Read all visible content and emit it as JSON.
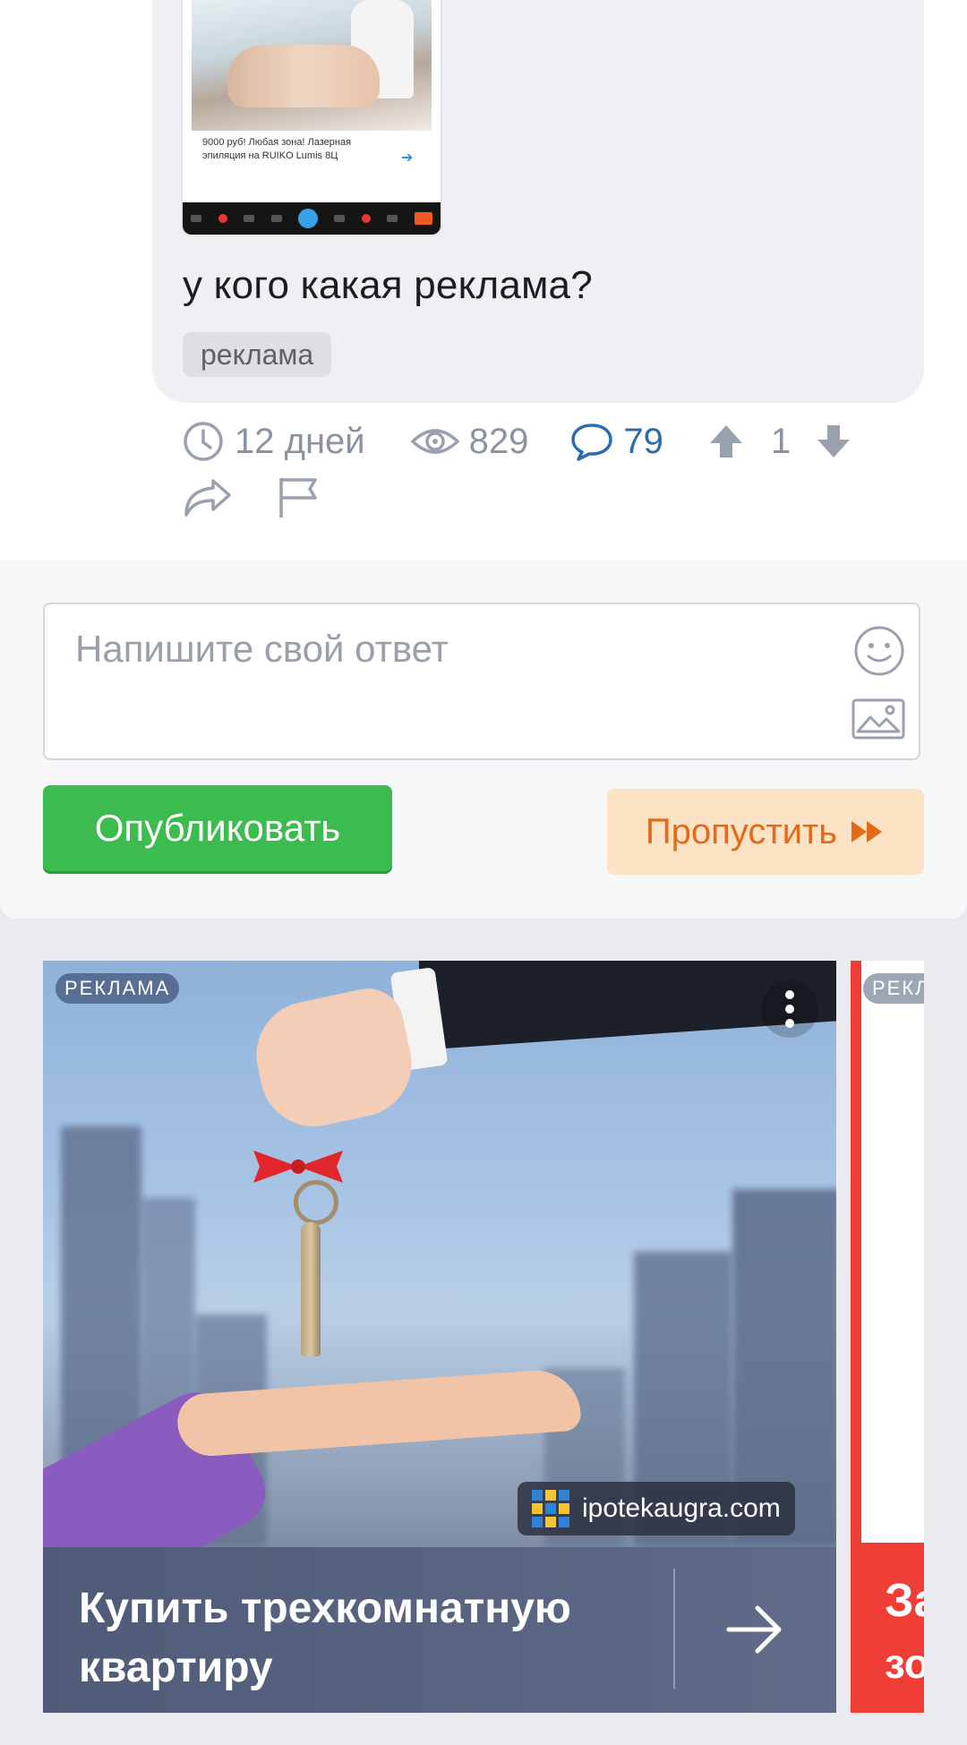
{
  "question": {
    "screenshot_caption": "9000 руб! Любая зона! Лазерная эпиляция на RUIKO Lumis 8Ц",
    "text": "у кого какая реклама?",
    "tag": "реклама"
  },
  "stats": {
    "age": "12 дней",
    "views": "829",
    "comments": "79",
    "votes": "1"
  },
  "reply": {
    "placeholder": "Напишите свой ответ",
    "publish_label": "Опубликовать",
    "skip_label": "Пропустить"
  },
  "ad": {
    "label": "РЕКЛАМА",
    "domain": "ipotekaugra.com",
    "title_line1": "Купить трехкомнатную",
    "title_line2": "квартиру"
  },
  "ad_next": {
    "label": "РЕКЛ",
    "title_line1": "За",
    "title_line2": "зо"
  },
  "colors": {
    "publish": "#3cbc4e",
    "skip_bg": "#fde3c5",
    "skip_text": "#e36a18",
    "comments": "#2b6cb0",
    "muted": "#8b93a3"
  }
}
